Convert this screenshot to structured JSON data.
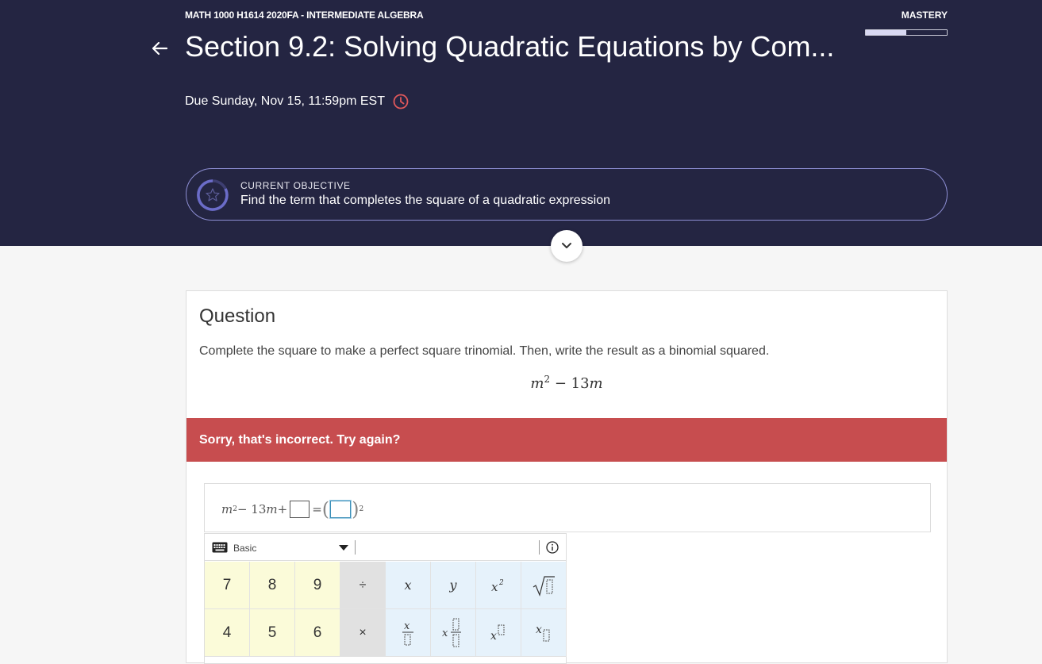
{
  "header": {
    "course": "MATH 1000 H1614 2020FA - INTERMEDIATE ALGEBRA",
    "mastery_label": "MASTERY",
    "mastery_progress": 0.5,
    "title": "Section 9.2: Solving Quadratic Equations by Com...",
    "due": "Due Sunday, Nov 15, 11:59pm EST"
  },
  "objective": {
    "kicker": "CURRENT OBJECTIVE",
    "text": "Find the term that completes the square of a quadratic expression"
  },
  "question": {
    "heading": "Question",
    "prompt": "Complete the square to make a perfect square trinomial. Then, write the result as a binomial squared.",
    "expr_var": "m",
    "expr_exp": "2",
    "expr_rest": " − 13",
    "expr_var2": "m"
  },
  "feedback": {
    "message": "Sorry, that's incorrect. Try again?"
  },
  "answer": {
    "var": "m",
    "exp": "2",
    "middle": " − 13",
    "var2": "m",
    "plus": " +",
    "equals": "=",
    "open_paren": "(",
    "close_paren": ")",
    "outer_exp": "2"
  },
  "keypad": {
    "mode": "Basic",
    "row1": [
      "7",
      "8",
      "9",
      "÷",
      "x",
      "y",
      "x²",
      "√"
    ],
    "row2": [
      "4",
      "5",
      "6",
      "×",
      "x/□",
      "x□/□",
      "x□",
      "x□"
    ]
  },
  "colors": {
    "header_bg": "#242542",
    "error_bg": "#c74d4f",
    "objective_border": "#8d8ed3",
    "clock": "#e0585b"
  }
}
